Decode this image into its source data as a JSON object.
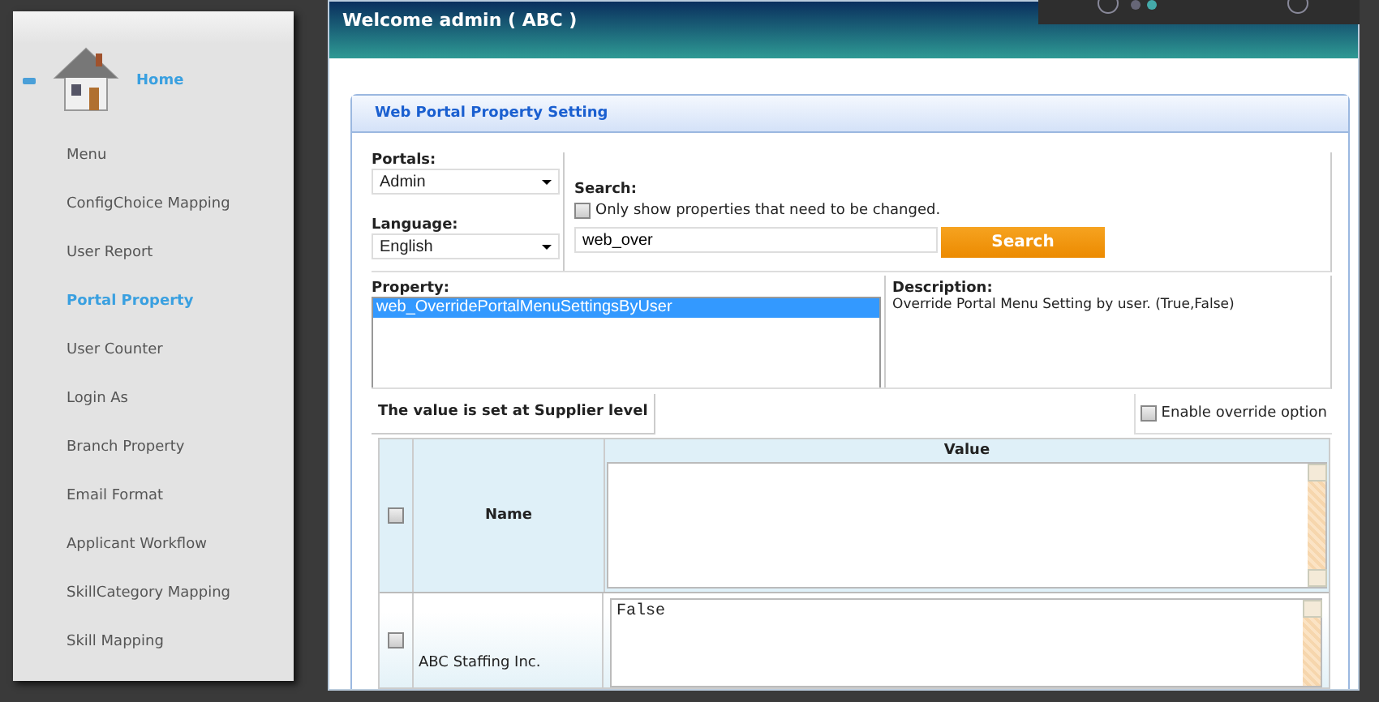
{
  "sidebar": {
    "home": {
      "label": "Home",
      "selected": true
    },
    "items": [
      {
        "label": "Menu",
        "selected": false
      },
      {
        "label": "ConfigChoice Mapping",
        "selected": false
      },
      {
        "label": "User Report",
        "selected": false
      },
      {
        "label": "Portal Property",
        "selected": true
      },
      {
        "label": "User Counter",
        "selected": false
      },
      {
        "label": "Login As",
        "selected": false
      },
      {
        "label": "Branch Property",
        "selected": false
      },
      {
        "label": "Email Format",
        "selected": false
      },
      {
        "label": "Applicant Workflow",
        "selected": false
      },
      {
        "label": "SkillCategory Mapping",
        "selected": false
      },
      {
        "label": "Skill Mapping",
        "selected": false
      }
    ]
  },
  "header": {
    "title": "Welcome admin ( ABC )"
  },
  "panel": {
    "title": "Web Portal Property Setting",
    "portals": {
      "label": "Portals:",
      "value": "Admin"
    },
    "language": {
      "label": "Language:",
      "value": "English"
    },
    "search": {
      "label": "Search:",
      "only_changed": {
        "label": "Only show properties that need to be changed.",
        "checked": false
      },
      "value": "web_over",
      "button": "Search"
    },
    "property": {
      "label": "Property:",
      "items": [
        {
          "label": "web_OverridePortalMenuSettingsByUser",
          "selected": true
        }
      ]
    },
    "description": {
      "label": "Description:",
      "text": "Override Portal Menu Setting by user. (True,False)"
    },
    "level_note": "The value is set at Supplier level",
    "enable_override": {
      "label": "Enable override option",
      "checked": false
    },
    "table": {
      "columns": [
        "Name",
        "Value"
      ],
      "select_all": false,
      "rows": [
        {
          "name": "ABC Staffing Inc.",
          "value": "False",
          "checked": false
        }
      ]
    }
  }
}
